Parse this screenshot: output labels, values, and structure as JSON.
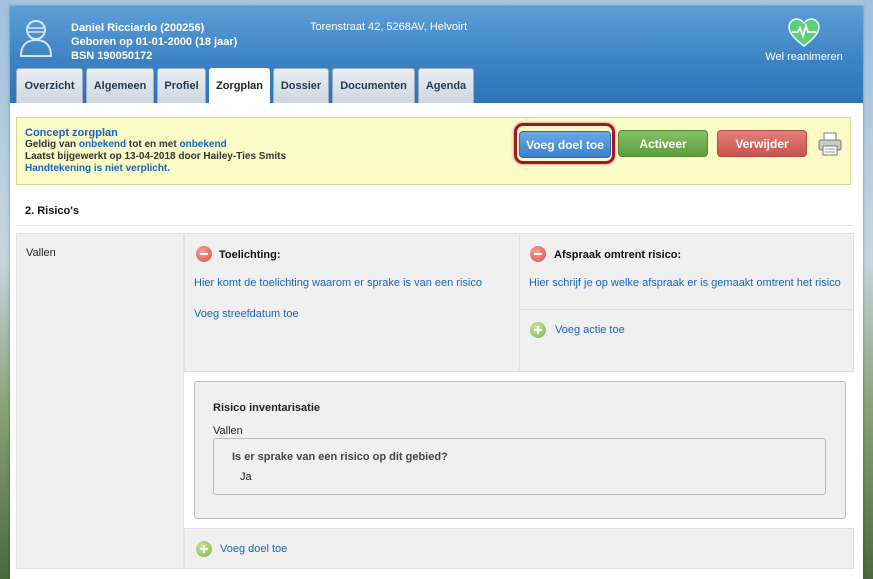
{
  "header": {
    "patient_name": "Daniel Ricciardo (200256)",
    "birth": "Geboren op 01-01-2000 (18 jaar)",
    "bsn": "BSN 190050172",
    "address": "Torenstraat 42, 5268AV, Helvoirt",
    "reanimation": "Wel reanimeren",
    "avatar_icon": "user-avatar-icon",
    "heart_icon": "heart-pulse-icon"
  },
  "tabs": [
    {
      "label": "Overzicht"
    },
    {
      "label": "Algemeen"
    },
    {
      "label": "Profiel"
    },
    {
      "label": "Zorgplan",
      "active": true
    },
    {
      "label": "Dossier"
    },
    {
      "label": "Documenten"
    },
    {
      "label": "Agenda"
    }
  ],
  "concept": {
    "title": "Concept zorgplan",
    "valid_prefix": "Geldig van",
    "valid_from": "onbekend",
    "valid_mid": "tot en met",
    "valid_to": "onbekend",
    "updated": "Laatst bijgewerkt op 13-04-2018 door Hailey-Ties Smits",
    "signature": "Handtekening is niet verplicht."
  },
  "buttons": {
    "add_goal": "Voeg doel toe",
    "activate": "Activeer",
    "delete": "Verwijder"
  },
  "section": {
    "title": "2. Risico's",
    "category": "Vallen"
  },
  "explanation": {
    "title": "Toelichting:",
    "text": "Hier komt de toelichting waarom er sprake is van een risico",
    "add_date": "Voeg streefdatum toe"
  },
  "agreement": {
    "title": "Afspraak omtrent risico:",
    "text": "Hier schrijf je op welke afspraak er is gemaakt omtrent het risico",
    "add_action": "Voeg actie toe"
  },
  "risk_inventory": {
    "title": "Risico inventarisatie",
    "subtitle": "Vallen",
    "question": "Is er sprake van een risico op dit gebied?",
    "answer": "Ja"
  },
  "footer": {
    "add_goal": "Voeg doel toe"
  },
  "colors": {
    "header_blue": "#3d83c4",
    "link_blue": "#1a63b8",
    "concept_bg": "#fbfbc8",
    "button_blue": "#3b7fd0",
    "button_green": "#5e9d3f",
    "button_red": "#c9524d",
    "highlight": "#a0172a"
  }
}
